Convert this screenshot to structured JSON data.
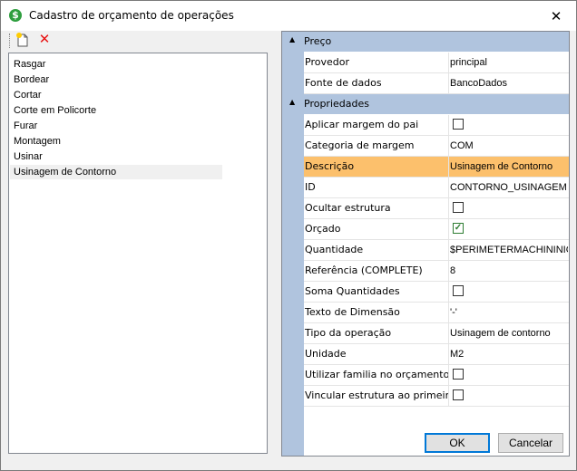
{
  "window": {
    "title": "Cadastro de orçamento de operações",
    "close_glyph": "✕",
    "icon_glyph": "$"
  },
  "toolbar": {
    "new_icon": "new-document-icon",
    "delete_icon": "delete-icon",
    "delete_glyph": "✕"
  },
  "list": {
    "items": [
      {
        "label": "Rasgar"
      },
      {
        "label": "Bordear"
      },
      {
        "label": "Cortar"
      },
      {
        "label": "Corte em Policorte"
      },
      {
        "label": "Furar"
      },
      {
        "label": "Montagem"
      },
      {
        "label": "Usinar"
      },
      {
        "label": "Usinagem de Contorno"
      }
    ],
    "selected_index": 7
  },
  "grid": {
    "categories": [
      {
        "label": "Preço",
        "toggle": "▲",
        "rows": [
          {
            "name": "Provedor",
            "value": "principal"
          },
          {
            "name": "Fonte de dados",
            "value": "BancoDados"
          }
        ]
      },
      {
        "label": "Propriedades",
        "toggle": "▲",
        "rows": [
          {
            "name": "Aplicar margem do pai",
            "checkbox": false
          },
          {
            "name": "Categoria de margem",
            "value": "COM"
          },
          {
            "name": "Descrição",
            "value": "Usinagem de Contorno",
            "selected": true
          },
          {
            "name": "ID",
            "value": "CONTORNO_USINAGEM"
          },
          {
            "name": "Ocultar estrutura",
            "checkbox": false
          },
          {
            "name": "Orçado",
            "checkbox": true
          },
          {
            "name": "Quantidade",
            "value": "$PERIMETERMACHININIG"
          },
          {
            "name": "Referência (COMPLETE)",
            "value": "8"
          },
          {
            "name": "Soma Quantidades",
            "checkbox": false
          },
          {
            "name": "Texto de Dimensão",
            "value": "'-'"
          },
          {
            "name": "Tipo da operação",
            "value": "Usinagem de contorno"
          },
          {
            "name": "Unidade",
            "value": "M2"
          },
          {
            "name": "Utilizar familia no orçamento",
            "checkbox": false
          },
          {
            "name": "Vincular estrutura ao primeir...",
            "checkbox": false
          }
        ]
      }
    ]
  },
  "buttons": {
    "ok": "OK",
    "cancel": "Cancelar"
  },
  "colors": {
    "selection": "#fcc06c",
    "category_bg": "#b0c4de",
    "accent": "#0078d7"
  }
}
